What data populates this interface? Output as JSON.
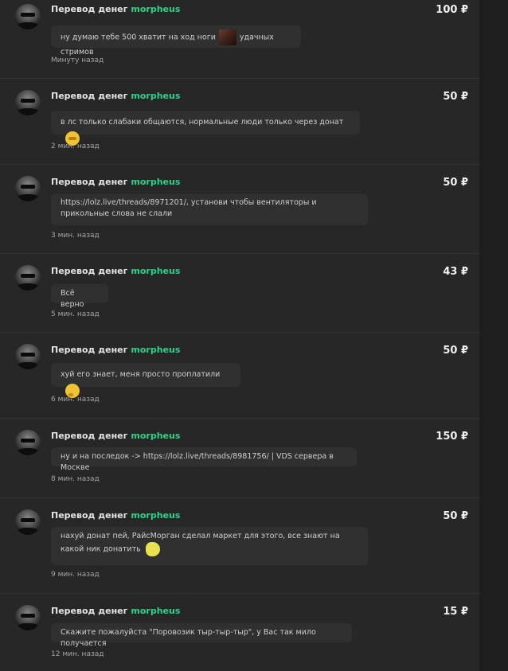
{
  "feed": {
    "items": [
      {
        "title": "Перевод денег",
        "username": "morpheus",
        "amount": "100 ₽",
        "message": "ну думаю тебе 500 хватит на ход ноги",
        "message_after": "удачных стримов",
        "time": "Минуту назад"
      },
      {
        "title": "Перевод денег",
        "username": "morpheus",
        "amount": "50 ₽",
        "message": "в лс только слабаки общаются, нормальные люди только через донат",
        "time": "2 мин. назад"
      },
      {
        "title": "Перевод денег",
        "username": "morpheus",
        "amount": "50 ₽",
        "message": "https://lolz.live/threads/8971201/, установи чтобы вентиляторы и прикольные слова не слали",
        "time": "3 мин. назад"
      },
      {
        "title": "Перевод денег",
        "username": "morpheus",
        "amount": "43 ₽",
        "message": "Всё верно",
        "time": "5 мин. назад"
      },
      {
        "title": "Перевод денег",
        "username": "morpheus",
        "amount": "50 ₽",
        "message": "хуй его знает, меня просто проплатили",
        "time": "6 мин. назад"
      },
      {
        "title": "Перевод денег",
        "username": "morpheus",
        "amount": "150 ₽",
        "message": "ну и на последок -> https://lolz.live/threads/8981756/ | VDS сервера в Москве",
        "time": "8 мин. назад"
      },
      {
        "title": "Перевод денег",
        "username": "morpheus",
        "amount": "50 ₽",
        "message": "нахуй донат пей, РайсМорган сделал маркет для этого, все знают на какой ник донатить",
        "time": "9 мин. назад"
      },
      {
        "title": "Перевод денег",
        "username": "morpheus",
        "amount": "15 ₽",
        "message": "Скажите пожалуйста \"Поровозик тыр-тыр-тыр\", у Вас так мило получается",
        "time": "12 мин. назад"
      }
    ]
  },
  "colors": {
    "username": "#2bd38a",
    "background": "#272727",
    "bubble": "#303030"
  }
}
